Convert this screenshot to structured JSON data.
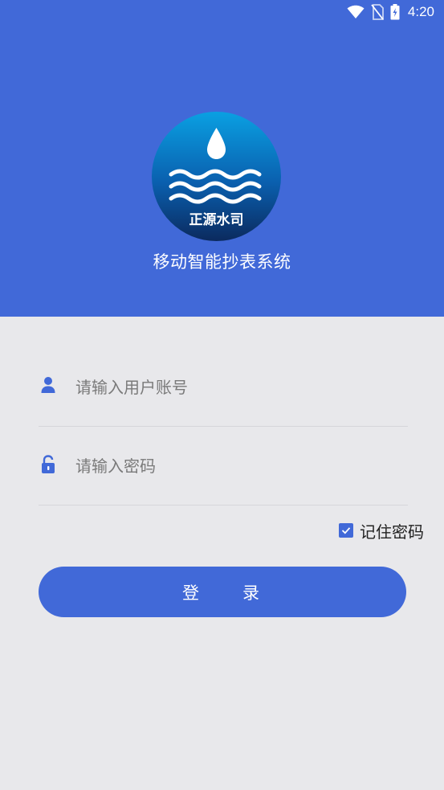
{
  "status_bar": {
    "time": "4:20",
    "icons": [
      "wifi-icon",
      "no-sim-icon",
      "battery-charging-icon"
    ]
  },
  "header": {
    "logo": {
      "icon": "water-drop-waves-logo",
      "text": "正源水司"
    },
    "app_title": "移动智能抄表系统",
    "color": "#4169d8"
  },
  "form": {
    "username": {
      "icon": "user-icon",
      "placeholder": "请输入用户账号",
      "value": ""
    },
    "password": {
      "icon": "lock-icon",
      "placeholder": "请输入密码",
      "value": ""
    },
    "remember": {
      "label": "记住密码",
      "checked": true,
      "icon": "checkbox-checked-icon"
    },
    "login_label": "登　　录"
  },
  "colors": {
    "primary": "#4169d8",
    "background": "#e8e8eb"
  }
}
